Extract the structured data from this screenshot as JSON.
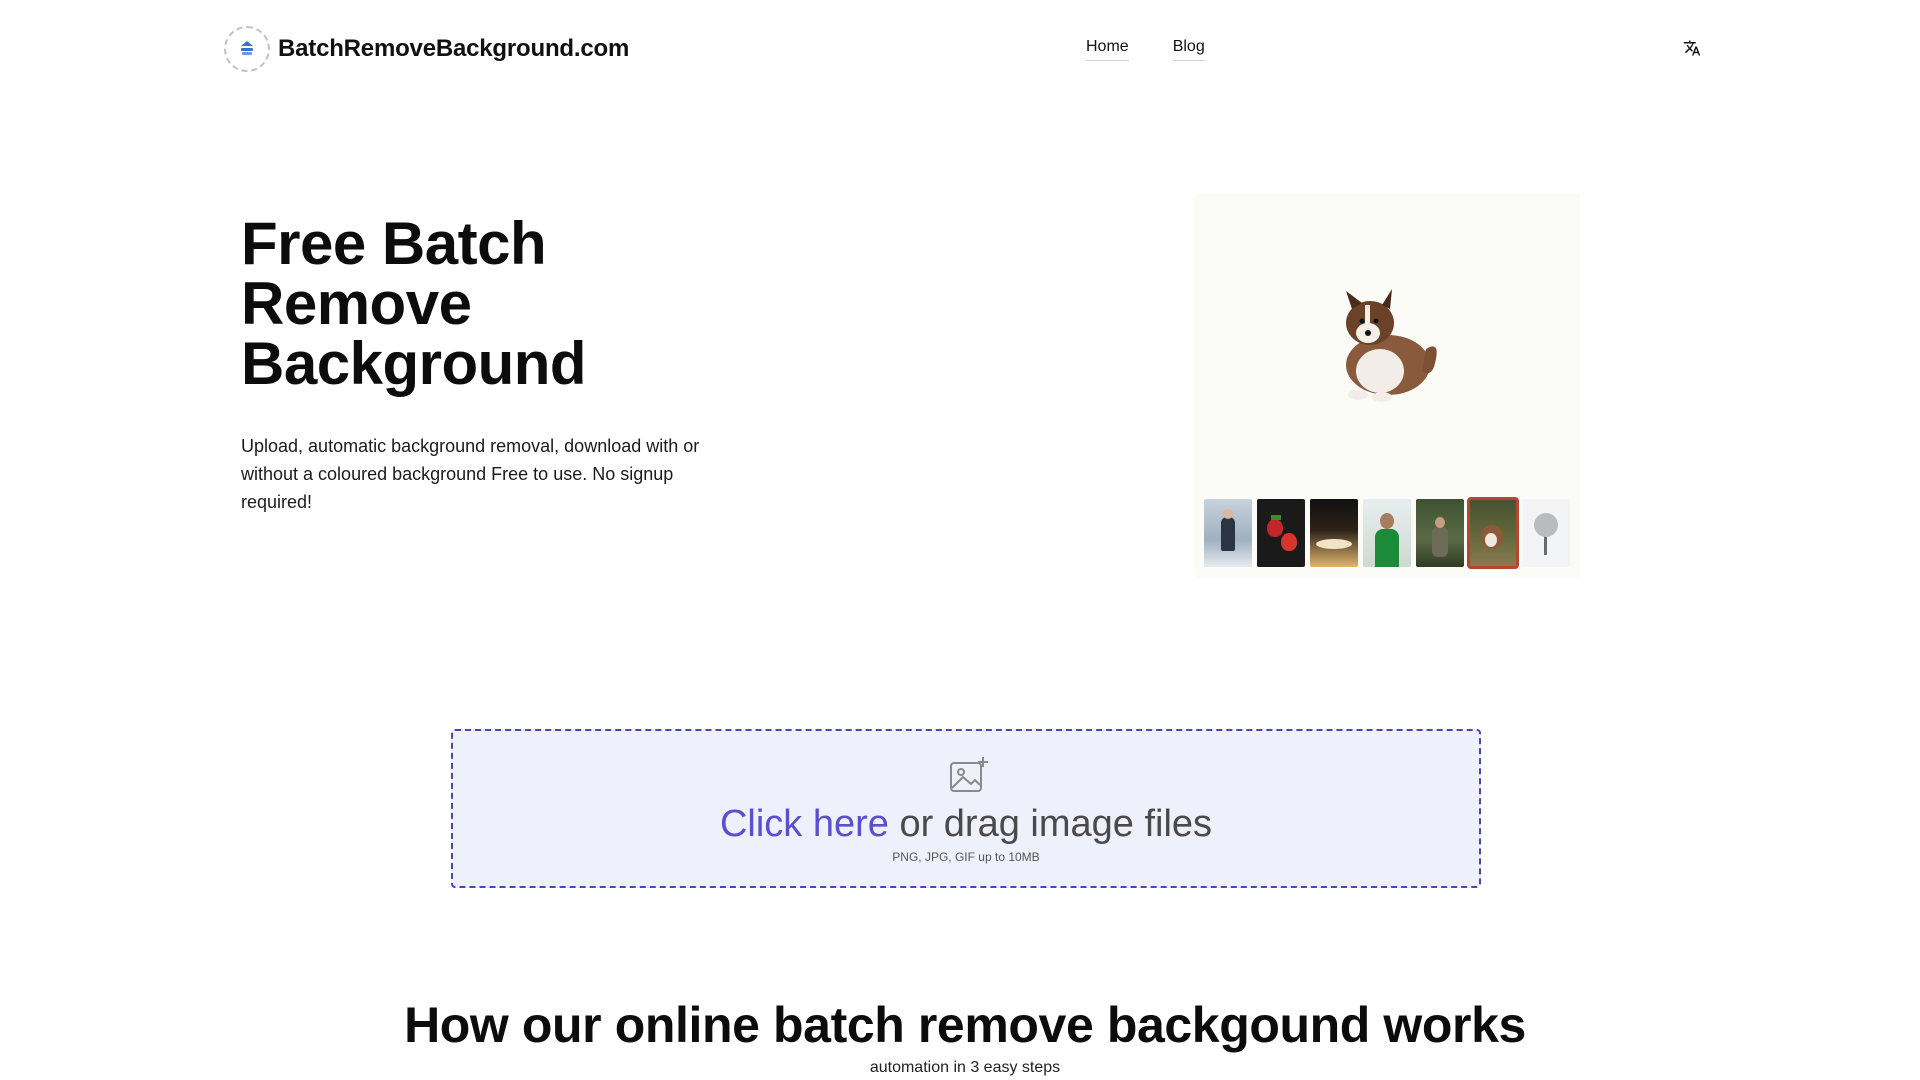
{
  "header": {
    "logo_text": "BatchRemoveBackground.com",
    "nav": [
      {
        "label": "Home"
      },
      {
        "label": "Blog"
      }
    ],
    "language_icon": "translate-icon"
  },
  "hero": {
    "title": "Free Batch Remove Background",
    "subtitle": "Upload, automatic background removal, download with or without a coloured background Free to use. No signup required!"
  },
  "preview": {
    "main_image": "dog-cutout",
    "thumbnails": [
      {
        "name": "person-in-snow",
        "selected": false
      },
      {
        "name": "strawberries",
        "selected": false
      },
      {
        "name": "food-on-table",
        "selected": false
      },
      {
        "name": "person-in-green",
        "selected": false
      },
      {
        "name": "person-outdoors",
        "selected": false
      },
      {
        "name": "dog-on-grass",
        "selected": true
      },
      {
        "name": "tree-in-snow",
        "selected": false
      }
    ]
  },
  "dropzone": {
    "click_text": "Click here",
    "rest_text": "or drag image files",
    "note": "PNG, JPG, GIF up to 10MB",
    "icon": "image-add-icon",
    "accent_color": "#5a4fd0"
  },
  "how": {
    "title": "How our online batch remove backgound works",
    "subtitle": "automation in 3 easy steps"
  }
}
